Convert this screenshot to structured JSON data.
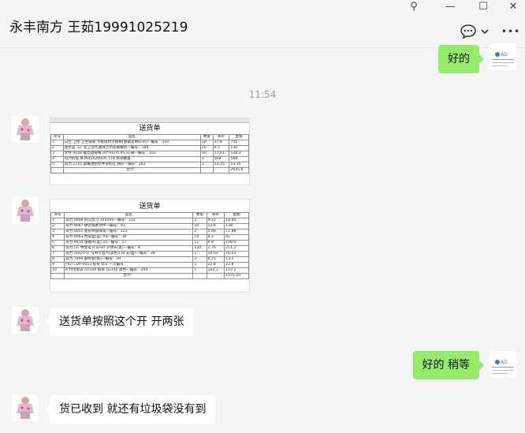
{
  "contact": {
    "name": "永丰南方 王茹19991025219"
  },
  "window": {
    "pin": "⚲",
    "minimize": "—",
    "maximize": "☐",
    "close": "✕"
  },
  "header": {
    "chat_icon": "…",
    "more": "•••",
    "chevron": "⌄"
  },
  "timestamp": "11:54",
  "messages": {
    "m1": "好的",
    "m4": "送货单按照这个开   开两张",
    "m5": "好的 稍等",
    "m6": "货已收到  就还有垃圾袋没有到"
  },
  "doc1": {
    "title": "送货单",
    "head": [
      "序号",
      "品名",
      "数量",
      "单价",
      "金额"
    ],
    "rows": [
      [
        "1",
        "日立 卫生 卫生纸筒 平板纸巾大规格(整箱定制6cm)—编号：316",
        "20",
        "37.8",
        "756"
      ],
      [
        "2",
        "速生蓝 工厂定卫浴卡通清洁剂装膜模剂—编号：189",
        "20",
        "6.5",
        "130"
      ],
      [
        "3",
        "文件 0028 螺丝短规格 30*91cm 95 只/箱—编号：103",
        "30",
        "17.61",
        "528.3"
      ],
      [
        "4",
        "得力的技 M3605X200DS 1TB 移动硬盘",
        "1",
        "568",
        "568"
      ],
      [
        "5",
        "得力 2710 晨曦透明文件夹标签 两份—编号：183",
        "1",
        "53.35",
        "53.35"
      ]
    ],
    "total_label": "合计：",
    "total": "2035.6"
  },
  "doc2": {
    "title": "送货单",
    "head": [
      "序号",
      "品名",
      "数量",
      "单价",
      "金额"
    ],
    "rows": [
      [
        "1",
        "得力 0009 办公剪刀 205mm—编号：112",
        "2",
        "9.32",
        "18.64"
      ],
      [
        "2",
        "得力 9087 便签纸本文件—编号：91",
        "10",
        "13.8",
        "138"
      ],
      [
        "3",
        "得力 0051 新形状圆珠笔—编号：123",
        "2",
        "5.94",
        "11.88"
      ],
      [
        "4",
        "得力 9063 档案盒(蓝) A4—编号：36",
        "10",
        "8.1",
        "81"
      ],
      [
        "5",
        "得力 9934 强磁夹(蓝) 25—编号：17",
        "11",
        "9.9",
        "108.9"
      ],
      [
        "6",
        "得力 (3) 中性笔 0.5mm 子弹头(黑)—编号：8",
        "120",
        "1.76",
        "211.2"
      ],
      [
        "7",
        "得力 (0410-5) 可书写直尺(黑色)(10 支/盒)—编号：38",
        "1",
        "16.03",
        "16.03"
      ],
      [
        "8",
        "得力 7049 磨砂套(黑)—编号：39",
        "2",
        "6.75",
        "13.5"
      ],
      [
        "9",
        "(Yu) CDP-0053 胶带 601 一次编号",
        "1",
        "22.8",
        "22.8"
      ],
      [
        "10",
        "e 代垃圾袋 (x)100 加厚 (x)240 黑色—编号：294",
        "1",
        "143.1",
        "143.1"
      ]
    ],
    "total_label": "合计：",
    "total": "1075.10"
  },
  "colors": {
    "accent_green": "#95ec69",
    "background": "#f5f5f5",
    "bubble_white": "#ffffff"
  }
}
